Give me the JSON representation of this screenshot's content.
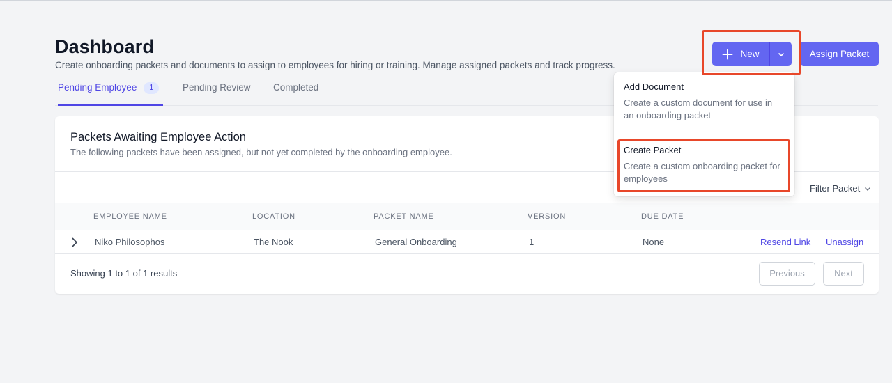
{
  "header": {
    "title": "Dashboard",
    "subtitle": "Create onboarding packets and documents to assign to employees for hiring or training. Manage assigned packets and track progress."
  },
  "actions": {
    "new_label": "New",
    "assign_label": "Assign Packet"
  },
  "tabs": [
    {
      "label": "Pending Employee",
      "badge": "1"
    },
    {
      "label": "Pending Review"
    },
    {
      "label": "Completed"
    }
  ],
  "card": {
    "title": "Packets Awaiting Employee Action",
    "description": "The following packets have been assigned, but not yet completed by the onboarding employee.",
    "filter_label": "Filter Packet"
  },
  "table": {
    "columns": [
      "EMPLOYEE NAME",
      "LOCATION",
      "PACKET NAME",
      "VERSION",
      "DUE DATE"
    ],
    "rows": [
      {
        "employee": "Niko Philosophos",
        "location": "The Nook",
        "packet": "General Onboarding",
        "version": "1",
        "due": "None",
        "action_resend": "Resend Link",
        "action_unassign": "Unassign"
      }
    ]
  },
  "pagination": {
    "summary": "Showing 1 to 1 of 1 results",
    "previous": "Previous",
    "next": "Next"
  },
  "dropdown": {
    "items": [
      {
        "title": "Add Document",
        "description": "Create a custom document for use in an onboarding packet"
      },
      {
        "title": "Create Packet",
        "description": "Create a custom onboarding packet for employees"
      }
    ]
  },
  "colors": {
    "accent": "#6366f1",
    "accent_text": "#4f46e5",
    "highlight": "#e8472a"
  }
}
